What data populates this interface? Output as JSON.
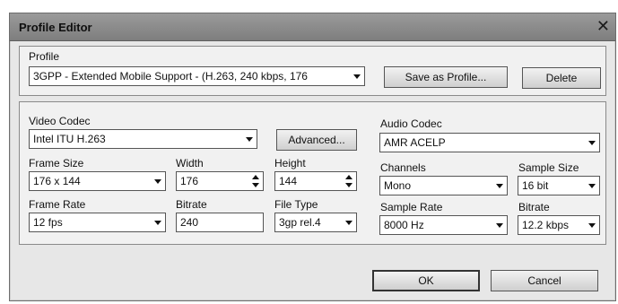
{
  "window": {
    "title": "Profile Editor",
    "close_glyph": "✕"
  },
  "profile": {
    "label": "Profile",
    "value": "3GPP - Extended Mobile Support - (H.263, 240 kbps, 176",
    "save_button": "Save as Profile...",
    "delete_button": "Delete"
  },
  "video": {
    "codec_label": "Video Codec",
    "codec_value": "Intel ITU H.263",
    "advanced_button": "Advanced...",
    "frame_size_label": "Frame Size",
    "frame_size_value": "176 x 144",
    "width_label": "Width",
    "width_value": "176",
    "height_label": "Height",
    "height_value": "144",
    "frame_rate_label": "Frame Rate",
    "frame_rate_value": "12 fps",
    "bitrate_label": "Bitrate",
    "bitrate_value": "240",
    "file_type_label": "File Type",
    "file_type_value": "3gp rel.4"
  },
  "audio": {
    "codec_label": "Audio Codec",
    "codec_value": "AMR ACELP",
    "channels_label": "Channels",
    "channels_value": "Mono",
    "sample_size_label": "Sample Size",
    "sample_size_value": "16 bit",
    "sample_rate_label": "Sample Rate",
    "sample_rate_value": "8000 Hz",
    "bitrate_label": "Bitrate",
    "bitrate_value": "12.2 kbps"
  },
  "footer": {
    "ok_button": "OK",
    "cancel_button": "Cancel"
  }
}
